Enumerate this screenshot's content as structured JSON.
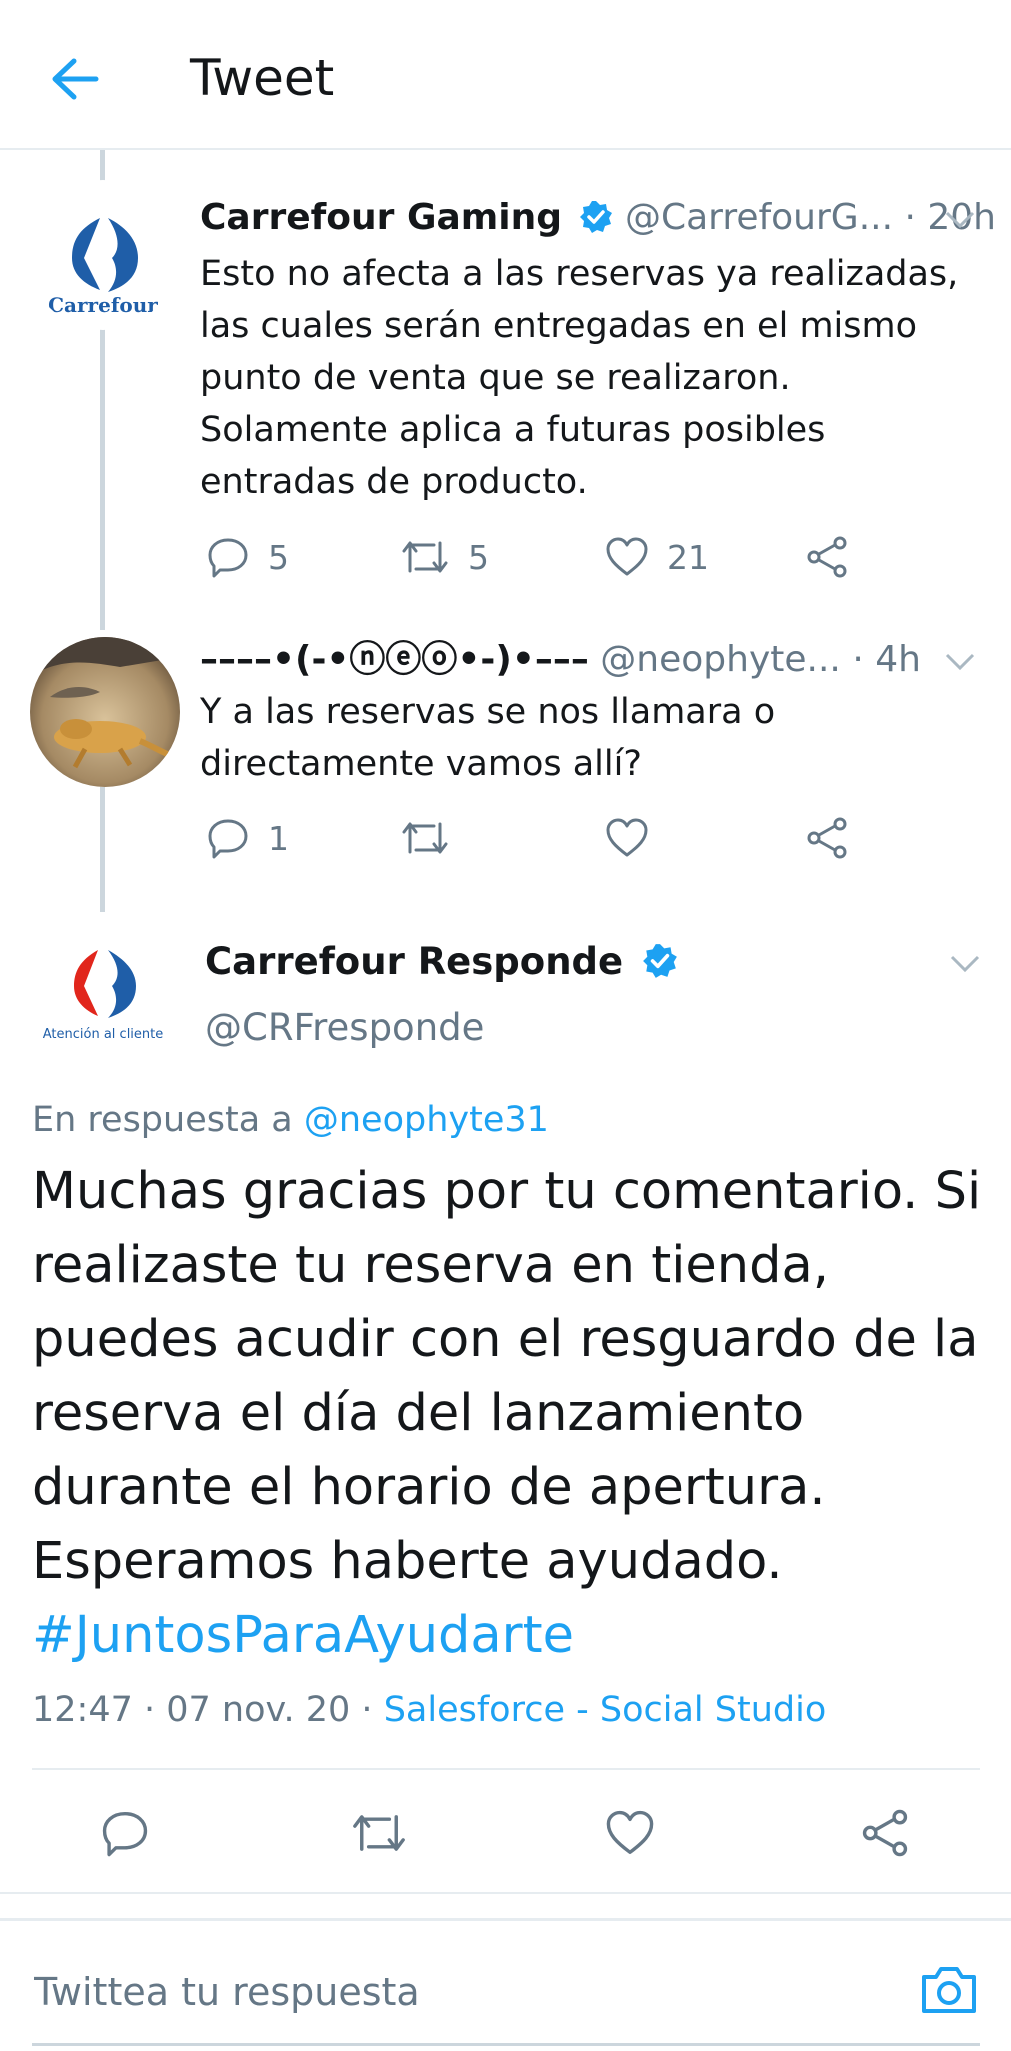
{
  "header": {
    "title": "Tweet"
  },
  "tweets": [
    {
      "name": "Carrefour Gaming",
      "handle": "@CarrefourG...",
      "time": "· 20h",
      "avatar_label": "Carrefour",
      "text": "Esto no afecta a las reservas ya realizadas, las cuales serán entregadas en el mismo punto de venta que se realizaron. Solamente aplica a futuras posibles entradas de producto.",
      "replies": "5",
      "retweets": "5",
      "likes": "21"
    },
    {
      "name": "––––•(-•ⓝⓔⓞ•-)•–––",
      "handle": "@neophyte...",
      "time": "· 4h",
      "text": "Y a las reservas se nos llamara o directamente vamos allí?",
      "replies": "1",
      "retweets": "",
      "likes": ""
    }
  ],
  "main_tweet": {
    "name": "Carrefour Responde",
    "handle": "@CRFresponde",
    "avatar_label": "Atención al cliente",
    "reply_prefix": "En respuesta a",
    "reply_to": "@neophyte31",
    "text": "Muchas gracias por tu comentario. Si realizaste tu reserva en tienda, puedes acudir con el resguardo de la reserva el día del lanzamiento durante el horario de apertura. Esperamos haberte ayudado.",
    "hashtag": "#JuntosParaAyudarte",
    "timestamp": "12:47 · 07 nov. 20 ·",
    "source": "Salesforce - Social Studio"
  },
  "reply_box": {
    "placeholder": "Twittea tu respuesta"
  },
  "colors": {
    "accent": "#1da1f2",
    "carrefour_blue": "#1f5ea8",
    "carrefour_red": "#e1261c",
    "secondary_text": "#657786"
  },
  "icons": [
    "back-arrow-icon",
    "verified-icon",
    "chevron-down-icon",
    "reply-icon",
    "retweet-icon",
    "like-icon",
    "share-icon",
    "camera-icon"
  ]
}
